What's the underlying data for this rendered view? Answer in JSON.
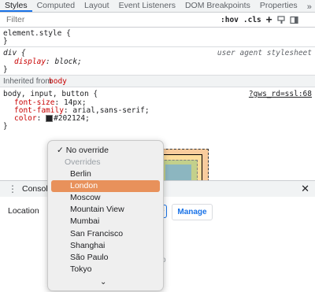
{
  "tabs": [
    "Styles",
    "Computed",
    "Layout",
    "Event Listeners",
    "DOM Breakpoints",
    "Properties"
  ],
  "tabs_more": "»",
  "filter": {
    "placeholder": "Filter",
    "hov": ":hov",
    "cls": ".cls",
    "add": "+"
  },
  "rules": {
    "element_style": {
      "selector": "element.style {",
      "close": "}"
    },
    "div_rule": {
      "selector": "div {",
      "source": "user agent stylesheet",
      "prop": "display",
      "value": "block;",
      "close": "}"
    },
    "inherited": {
      "prefix": "Inherited from",
      "tag": "body"
    },
    "body_rule": {
      "selector": "body, input, button {",
      "source": "?gws_rd=ssl:68",
      "props": [
        {
          "name": "font-size",
          "value": "14px;"
        },
        {
          "name": "font-family",
          "value": "arial,sans-serif;"
        },
        {
          "name": "color",
          "value": "#202124;"
        }
      ],
      "close": "}"
    }
  },
  "drawer": {
    "tab": "Console",
    "close": "✕",
    "kebab": "⋮"
  },
  "sensors": {
    "location_label": "Location",
    "manage_button": "Manage",
    "stray": "o"
  },
  "dropdown": {
    "selected": "London",
    "options": [
      {
        "label": "✓ No override",
        "kind": "first"
      },
      {
        "label": "Overrides",
        "kind": "group"
      },
      {
        "label": "Berlin",
        "kind": "item"
      },
      {
        "label": "London",
        "kind": "selected"
      },
      {
        "label": "Moscow",
        "kind": "item"
      },
      {
        "label": "Mountain View",
        "kind": "item"
      },
      {
        "label": "Mumbai",
        "kind": "item"
      },
      {
        "label": "San Francisco",
        "kind": "item"
      },
      {
        "label": "Shanghai",
        "kind": "item"
      },
      {
        "label": "São Paulo",
        "kind": "item"
      },
      {
        "label": "Tokyo",
        "kind": "item"
      }
    ],
    "scroll_indicator": "⌄"
  },
  "colors": {
    "accent": "#1a73e8",
    "selected_bg": "#e8915b",
    "prop_red": "#c80000"
  }
}
